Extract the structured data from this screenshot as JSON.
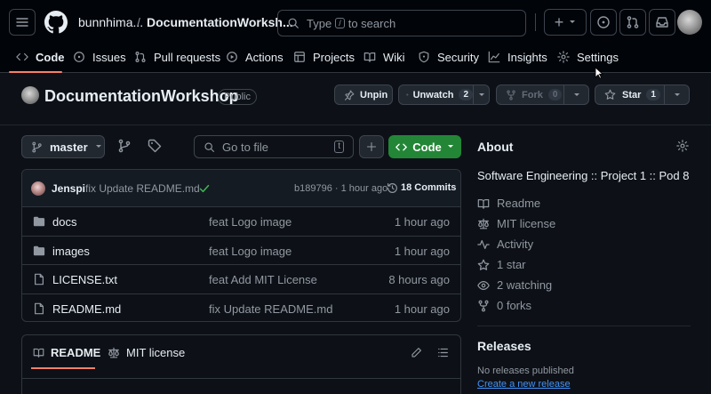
{
  "header": {
    "owner": "bunnhima...",
    "separator": "/",
    "repo": "DocumentationWorksh...",
    "search_placeholder_pre": "Type",
    "search_key": "/",
    "search_placeholder_post": "to search",
    "new_label": "+"
  },
  "repo_nav": {
    "tabs": [
      {
        "label": "Code",
        "icon": "code-icon",
        "selected": true
      },
      {
        "label": "Issues",
        "icon": "issue-icon"
      },
      {
        "label": "Pull requests",
        "icon": "pull-request-icon"
      },
      {
        "label": "Actions",
        "icon": "play-icon"
      },
      {
        "label": "Projects",
        "icon": "table-icon"
      },
      {
        "label": "Wiki",
        "icon": "book-icon"
      },
      {
        "label": "Security",
        "icon": "shield-icon"
      },
      {
        "label": "Insights",
        "icon": "graph-icon"
      },
      {
        "label": "Settings",
        "icon": "gear-icon"
      }
    ]
  },
  "repo_header": {
    "name": "DocumentationWorkshop",
    "visibility": "Public",
    "unpin": "Unpin",
    "unwatch": "Unwatch",
    "watch_count": "2",
    "fork": "Fork",
    "fork_count": "0",
    "star": "Star",
    "star_count": "1"
  },
  "toolbar": {
    "branch": "master",
    "go_to_file": "Go to file",
    "go_to_file_key": "t",
    "code_button": "Code"
  },
  "latest_commit": {
    "author": "Jenspi",
    "message": "fix Update README.md",
    "hash_time": "b189796 · 1 hour ago",
    "commits": "18 Commits"
  },
  "files": [
    {
      "name": "docs",
      "type": "folder",
      "message": "feat Logo image",
      "time": "1 hour ago"
    },
    {
      "name": "images",
      "type": "folder",
      "message": "feat Logo image",
      "time": "1 hour ago"
    },
    {
      "name": "LICENSE.txt",
      "type": "file",
      "message": "feat Add MIT License",
      "time": "8 hours ago"
    },
    {
      "name": "README.md",
      "type": "file",
      "message": "fix Update README.md",
      "time": "1 hour ago"
    }
  ],
  "readme_tabs": {
    "readme": "README",
    "license": "MIT license"
  },
  "about": {
    "title": "About",
    "description": "Software Engineering :: Project 1 :: Pod 8",
    "items": [
      {
        "icon": "book-icon",
        "label": "Readme"
      },
      {
        "icon": "law-icon",
        "label": "MIT license"
      },
      {
        "icon": "pulse-icon",
        "label": "Activity"
      },
      {
        "icon": "star-icon",
        "label": "1 star"
      },
      {
        "icon": "eye-icon",
        "label": "2 watching"
      },
      {
        "icon": "fork-icon",
        "label": "0 forks"
      }
    ]
  },
  "releases": {
    "title": "Releases",
    "none": "No releases published",
    "create": "Create a new release"
  },
  "colors": {
    "accent_green": "#238636",
    "underline": "#f78166",
    "link": "#4493f8",
    "bg": "#0d1117"
  }
}
